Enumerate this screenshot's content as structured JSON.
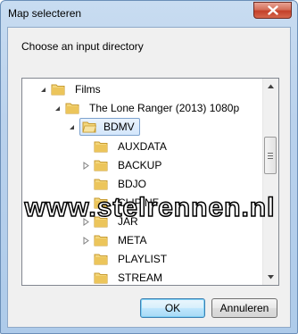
{
  "window": {
    "title": "Map selecteren"
  },
  "dialog": {
    "prompt": "Choose an input directory"
  },
  "tree": {
    "items": [
      {
        "label": "Films",
        "expanded": true,
        "selected": false,
        "has_children": true
      },
      {
        "label": "The Lone Ranger (2013) 1080p",
        "expanded": true,
        "selected": false,
        "has_children": true
      },
      {
        "label": "BDMV",
        "expanded": true,
        "selected": true,
        "has_children": true
      },
      {
        "label": "AUXDATA",
        "expanded": false,
        "selected": false,
        "has_children": false
      },
      {
        "label": "BACKUP",
        "expanded": false,
        "selected": false,
        "has_children": true
      },
      {
        "label": "BDJO",
        "expanded": false,
        "selected": false,
        "has_children": false
      },
      {
        "label": "CLIPINF",
        "expanded": false,
        "selected": false,
        "has_children": false
      },
      {
        "label": "JAR",
        "expanded": false,
        "selected": false,
        "has_children": true
      },
      {
        "label": "META",
        "expanded": false,
        "selected": false,
        "has_children": true
      },
      {
        "label": "PLAYLIST",
        "expanded": false,
        "selected": false,
        "has_children": false
      },
      {
        "label": "STREAM",
        "expanded": false,
        "selected": false,
        "has_children": false
      }
    ]
  },
  "buttons": {
    "ok_label": "OK",
    "cancel_label": "Annuleren"
  },
  "watermark": {
    "text": "www.stelrennen.nl"
  },
  "icons": {
    "close": "close-icon",
    "folder": "folder-icon",
    "expanded_arrow": "triangle-expanded-icon",
    "collapsed_arrow": "triangle-collapsed-icon",
    "scroll_up": "arrow-up-icon",
    "scroll_down": "arrow-down-icon"
  },
  "colors": {
    "selection_border": "#7da2ce",
    "selection_fill": "#d3e6fb",
    "close_button": "#c4402a",
    "folder": "#e8c25a"
  }
}
